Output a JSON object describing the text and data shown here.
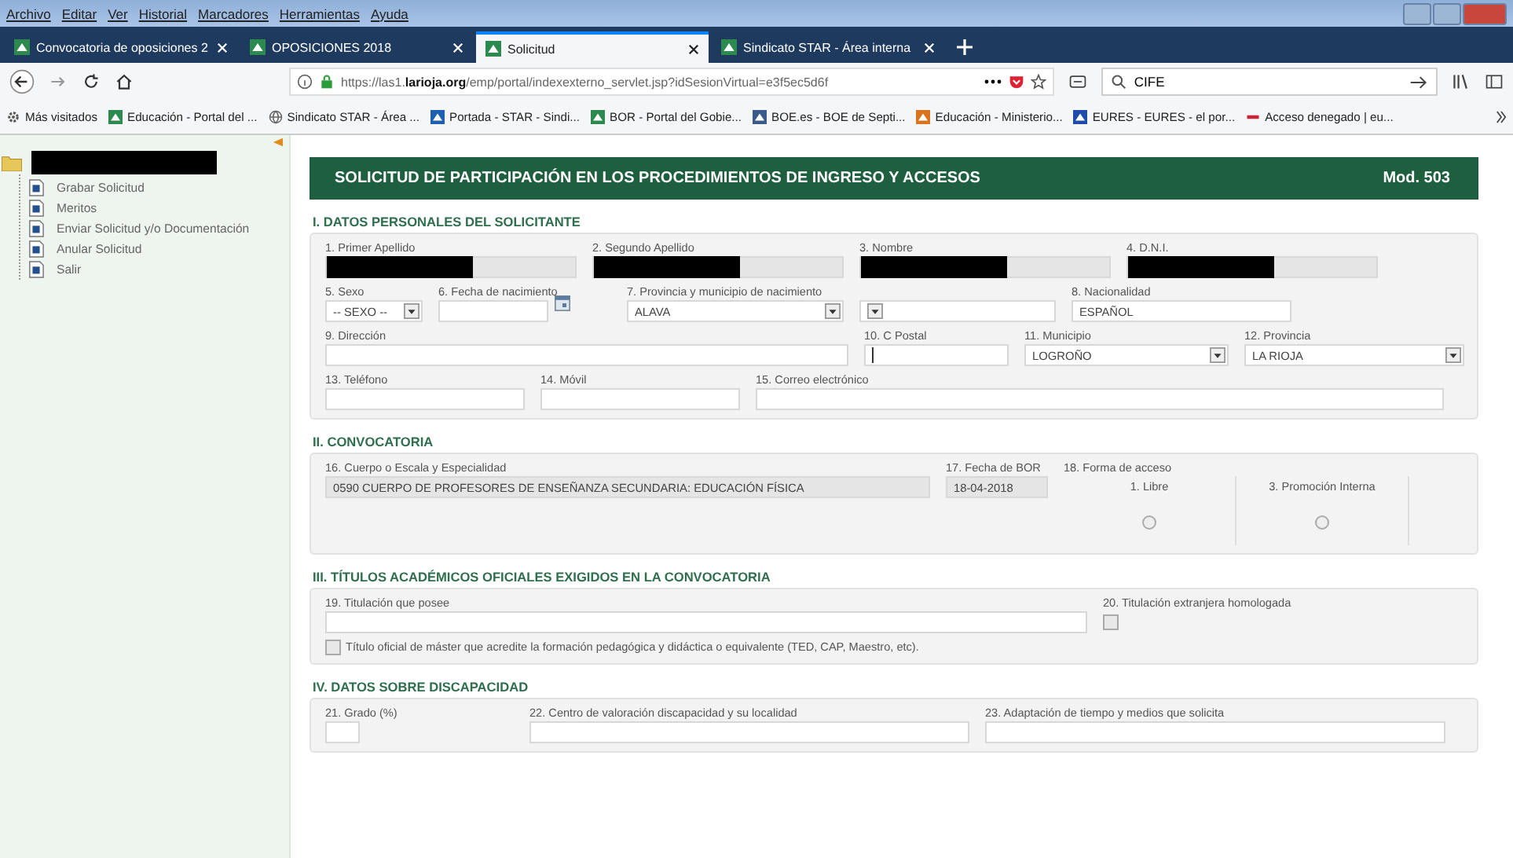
{
  "browser": {
    "menu": [
      "Archivo",
      "Editar",
      "Ver",
      "Historial",
      "Marcadores",
      "Herramientas",
      "Ayuda"
    ],
    "tabs": [
      {
        "label": "Convocatoria de oposiciones 2",
        "selected": false
      },
      {
        "label": "OPOSICIONES 2018",
        "selected": false
      },
      {
        "label": "Solicitud",
        "selected": true
      },
      {
        "label": "Sindicato STAR - Área interna",
        "selected": false
      }
    ],
    "url": "https://las1.**larioja.org**/emp/portal/indexexterno_servlet.jsp?idSesionVirtual=e3f5ec5d6f",
    "search": "CIFE",
    "bookmarks": [
      {
        "label": "Más visitados",
        "kind": "gear"
      },
      {
        "label": "Educación - Portal del ...",
        "kind": "green"
      },
      {
        "label": "Sindicato STAR - Área ...",
        "kind": "globe"
      },
      {
        "label": "Portada - STAR - Sindi...",
        "kind": "blue"
      },
      {
        "label": "BOR - Portal del Gobie...",
        "kind": "green"
      },
      {
        "label": "BOE.es - BOE de Septi...",
        "kind": "boe"
      },
      {
        "label": "Educación - Ministerio...",
        "kind": "orange"
      },
      {
        "label": "EURES - EURES - el por...",
        "kind": "eu"
      },
      {
        "label": "Acceso denegado | eu...",
        "kind": "ep"
      }
    ]
  },
  "sidebar": {
    "root_redacted": true,
    "items": [
      "Grabar Solicitud",
      "Meritos",
      "Enviar Solicitud y/o Documentación",
      "Anular Solicitud",
      "Salir"
    ]
  },
  "form": {
    "title": "SOLICITUD DE PARTICIPACIÓN EN LOS PROCEDIMIENTOS DE INGRESO Y ACCESOS",
    "code": "Mod. 503",
    "sections": [
      {
        "title": "I. DATOS PERSONALES DEL SOLICITANTE",
        "rows": [
          [
            {
              "label": "1. Primer Apellido",
              "kind": "text",
              "readonly": true,
              "redacted": true
            },
            {
              "label": "2. Segundo Apellido",
              "kind": "text",
              "readonly": true,
              "redacted": true
            },
            {
              "label": "3. Nombre",
              "kind": "text",
              "readonly": true,
              "redacted": true
            },
            {
              "label": "4. D.N.I.",
              "kind": "text",
              "readonly": true,
              "redacted": true
            }
          ],
          [
            {
              "label": "5. Sexo",
              "kind": "select",
              "value": "-- SEXO --"
            },
            {
              "label": "6. Fecha de nacimiento",
              "kind": "date"
            },
            {
              "label": "7. Provincia y municipio de nacimiento",
              "kind": "select",
              "value": "ALAVA"
            },
            {
              "kind": "select"
            },
            {
              "label": "8. Nacionalidad",
              "kind": "text",
              "value": "ESPAÑOL"
            }
          ],
          [
            {
              "label": "9. Dirección",
              "kind": "text"
            },
            {
              "label": "10. C Postal",
              "kind": "text",
              "focused": true
            },
            {
              "label": "11. Municipio",
              "kind": "select",
              "value": "LOGROÑO"
            },
            {
              "label": "12. Provincia",
              "kind": "select",
              "value": "LA RIOJA"
            }
          ],
          [
            {
              "label": "13. Teléfono",
              "kind": "text"
            },
            {
              "label": "14. Móvil",
              "kind": "text"
            },
            {
              "label": "15. Correo electrónico",
              "kind": "text"
            }
          ]
        ]
      },
      {
        "title": "II. CONVOCATORIA",
        "rows": [
          [
            {
              "label": "16. Cuerpo o Escala y Especialidad",
              "kind": "text",
              "readonly": true,
              "value": "0590 CUERPO DE PROFESORES DE ENSEÑANZA SECUNDARIA: EDUCACIÓN FÍSICA"
            },
            {
              "label": "17. Fecha de BOR",
              "kind": "text",
              "readonly": true,
              "value": "18-04-2018"
            },
            {
              "label": "18. Forma de acceso",
              "kind": "radio_group",
              "options": [
                {
                  "label": "1. Libre",
                  "selected": false
                },
                {
                  "label": "3. Promoción Interna",
                  "selected": false
                }
              ]
            }
          ]
        ]
      },
      {
        "title": "III. TÍTULOS ACADÉMICOS OFICIALES EXIGIDOS EN LA CONVOCATORIA",
        "rows": [
          [
            {
              "label": "19. Titulación que posee",
              "kind": "text"
            },
            {
              "label": "20. Titulación extranjera homologada",
              "kind": "checkbox",
              "checked": false
            }
          ],
          [
            {
              "label": "Título oficial de máster que acredite la formación pedagógica y didáctica o equivalente (TED, CAP, Maestro, etc).",
              "kind": "inline_checkbox",
              "checked": false
            }
          ]
        ]
      },
      {
        "title": "IV. DATOS SOBRE DISCAPACIDAD",
        "rows": [
          [
            {
              "label": "21. Grado (%)",
              "kind": "number"
            },
            {
              "label": "22. Centro de valoración discapacidad y su localidad",
              "kind": "text"
            },
            {
              "label": "23. Adaptación de tiempo y medios que solicita",
              "kind": "text"
            }
          ]
        ]
      }
    ]
  }
}
